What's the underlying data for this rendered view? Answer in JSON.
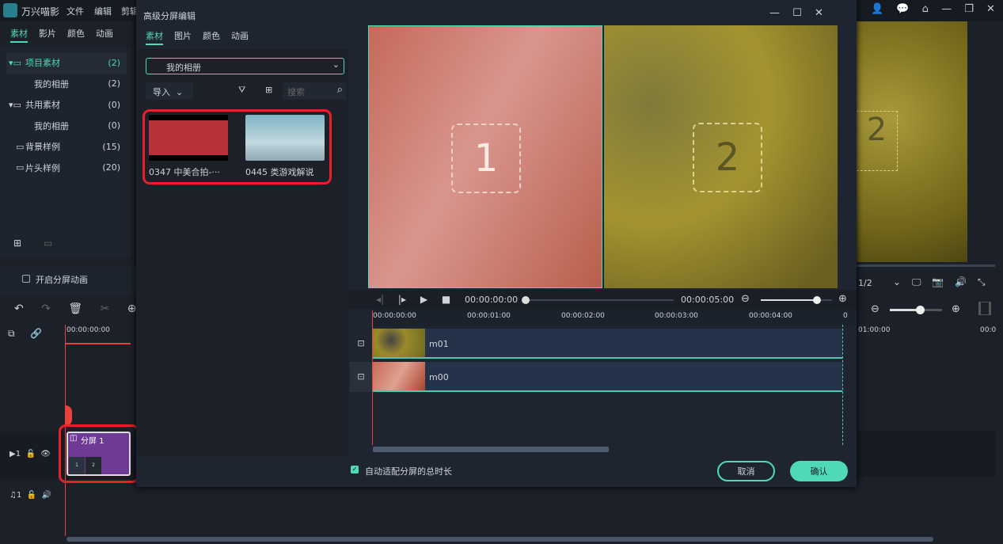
{
  "app": {
    "name": "万兴喵影",
    "menu": [
      "文件",
      "编辑",
      "剪辑"
    ]
  },
  "left_panel": {
    "tabs": [
      "素材",
      "影片",
      "颜色",
      "动画"
    ],
    "active_tab": 0,
    "tree": [
      {
        "label": "项目素材",
        "count": "(2)",
        "expanded": true,
        "active": true
      },
      {
        "label": "我的相册",
        "count": "(2)",
        "child": true
      },
      {
        "label": "共用素材",
        "count": "(0)",
        "expanded": true
      },
      {
        "label": "我的相册",
        "count": "(0)",
        "child": true
      },
      {
        "label": "背景样例",
        "count": "(15)"
      },
      {
        "label": "片头样例",
        "count": "(20)"
      }
    ],
    "split_anim_label": "开启分屏动画",
    "split_anim_checked": false
  },
  "timeline_main": {
    "timecode": "00:00:00:00",
    "clip_label": "分屏 1",
    "clip_slots": [
      "1",
      "2"
    ],
    "video_track": "1",
    "audio_track": "1"
  },
  "dialog": {
    "title": "高级分屏编辑",
    "tabs": [
      "素材",
      "图片",
      "颜色",
      "动画"
    ],
    "active_tab": 0,
    "album_select": "我的相册",
    "import_label": "导入",
    "search_placeholder": "搜索",
    "media": [
      {
        "label": "0347 中美合拍-···"
      },
      {
        "label": "0445 类游戏解说"
      }
    ],
    "preview_slots": [
      "1",
      "2"
    ],
    "playback": {
      "current": "00:00:00:00",
      "total": "00:00:05:00",
      "progress": 0,
      "zoom": 0.93
    },
    "ruler": [
      "00:00:00:00",
      "00:00:01:00",
      "00:00:02:00",
      "00:00:03:00",
      "00:00:04:00",
      "0"
    ],
    "tracks": [
      {
        "name": "m01"
      },
      {
        "name": "m00"
      }
    ],
    "auto_fit_label": "自动适配分屏的总时长",
    "auto_fit_checked": true,
    "cancel": "取消",
    "confirm": "确认"
  },
  "right_panel": {
    "page": "1/2",
    "ruler": [
      "01:00:00",
      "00:0"
    ],
    "zoom": 0.55,
    "slot": "2"
  },
  "colors": {
    "accent": "#4fd9b8",
    "highlight": "#e8202a",
    "clip": "#6e3a96"
  }
}
